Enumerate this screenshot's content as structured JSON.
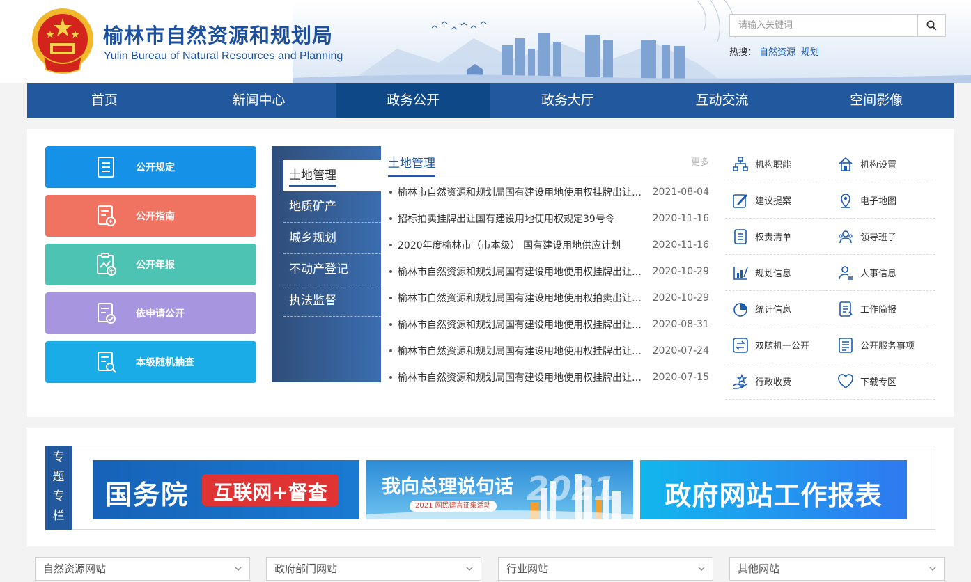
{
  "header": {
    "title": "榆林市自然资源和规划局",
    "subtitle": "Yulin Bureau of Natural Resources and Planning",
    "search_placeholder": "请输入关键词",
    "hot_label": "热搜：",
    "hot_links": [
      "自然资源",
      "规划"
    ]
  },
  "nav": {
    "items": [
      "首页",
      "新闻中心",
      "政务公开",
      "政务大厅",
      "互动交流",
      "空间影像"
    ],
    "active": "政务公开"
  },
  "left_buttons": [
    {
      "label": "公开规定",
      "color": "#1591e8",
      "icon": "list-doc-icon"
    },
    {
      "label": "公开指南",
      "color": "#f07260",
      "icon": "guide-doc-icon"
    },
    {
      "label": "公开年报",
      "color": "#4dc3b3",
      "icon": "annual-report-icon"
    },
    {
      "label": "依申请公开",
      "color": "#a795e0",
      "icon": "application-doc-icon"
    },
    {
      "label": "本级随机抽查",
      "color": "#1aace6",
      "icon": "inspect-doc-icon"
    }
  ],
  "side_menu": {
    "items": [
      "土地管理",
      "地质矿产",
      "城乡规划",
      "不动产登记",
      "执法监督"
    ],
    "active": "土地管理"
  },
  "news": {
    "title": "土地管理",
    "more": "更多",
    "items": [
      {
        "text": "榆林市自然资源和规划局国有建设用地使用权挂牌出让公告",
        "date": "2021-08-04"
      },
      {
        "text": "招标拍卖挂牌出让国有建设用地使用权规定39号令",
        "date": "2020-11-16"
      },
      {
        "text": "2020年度榆林市（市本级） 国有建设用地供应计划",
        "date": "2020-11-16"
      },
      {
        "text": "榆林市自然资源和规划局国有建设用地使用权挂牌出让公告",
        "date": "2020-10-29"
      },
      {
        "text": "榆林市自然资源和规划局国有建设用地使用权拍卖出让公告",
        "date": "2020-10-29"
      },
      {
        "text": "榆林市自然资源和规划局国有建设用地使用权挂牌出让公告",
        "date": "2020-08-31"
      },
      {
        "text": "榆林市自然资源和规划局国有建设用地使用权挂牌出让公告",
        "date": "2020-07-24"
      },
      {
        "text": "榆林市自然资源和规划局国有建设用地使用权挂牌出让公告",
        "date": "2020-07-15"
      }
    ]
  },
  "quick_links": [
    {
      "label": "机构职能",
      "icon": "org-chart-icon"
    },
    {
      "label": "机构设置",
      "icon": "building-icon"
    },
    {
      "label": "建议提案",
      "icon": "edit-note-icon"
    },
    {
      "label": "电子地图",
      "icon": "map-pin-icon"
    },
    {
      "label": "权责清单",
      "icon": "checklist-icon"
    },
    {
      "label": "领导班子",
      "icon": "team-icon"
    },
    {
      "label": "规划信息",
      "icon": "bar-chart-icon"
    },
    {
      "label": "人事信息",
      "icon": "person-icon"
    },
    {
      "label": "统计信息",
      "icon": "pie-chart-icon"
    },
    {
      "label": "工作简报",
      "icon": "report-icon"
    },
    {
      "label": "双随机一公开",
      "icon": "shuffle-icon"
    },
    {
      "label": "公开服务事项",
      "icon": "service-list-icon"
    },
    {
      "label": "行政收费",
      "icon": "fee-hand-icon"
    },
    {
      "label": "下载专区",
      "icon": "heart-download-icon"
    }
  ],
  "topics": {
    "tag": [
      "专",
      "题",
      "专",
      "栏"
    ],
    "banner1": {
      "left": "国务院",
      "right": "互联网+督查"
    },
    "banner2": {
      "main": "我向总理说句话",
      "sub": "2021 网民建言征集活动",
      "year": "2021"
    },
    "banner3": {
      "text": "政府网站工作报表"
    }
  },
  "footer_selects": [
    "自然资源网站",
    "政府部门网站",
    "行业网站",
    "其他网站"
  ],
  "colors": {
    "brand": "#1c4f9c",
    "nav": "#22589e",
    "nav_active": "#0e4886"
  }
}
